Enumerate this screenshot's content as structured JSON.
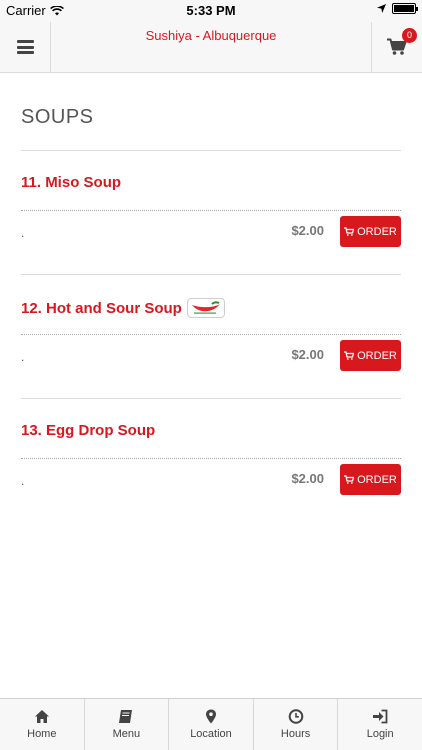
{
  "status_bar": {
    "carrier": "Carrier",
    "time": "5:33 PM"
  },
  "header": {
    "title": "Sushiya - Albuquerque",
    "cart_count": "0"
  },
  "section": {
    "title": "SOUPS"
  },
  "items": [
    {
      "name": "11. Miso Soup",
      "desc": ".",
      "price": "$2.00",
      "order_label": "ORDER",
      "spicy": false
    },
    {
      "name": "12. Hot and Sour Soup",
      "desc": ".",
      "price": "$2.00",
      "order_label": "ORDER",
      "spicy": true
    },
    {
      "name": "13. Egg Drop Soup",
      "desc": ".",
      "price": "$2.00",
      "order_label": "ORDER",
      "spicy": false
    }
  ],
  "tabs": [
    {
      "label": "Home",
      "icon": "home-icon"
    },
    {
      "label": "Menu",
      "icon": "book-icon"
    },
    {
      "label": "Location",
      "icon": "map-marker-icon"
    },
    {
      "label": "Hours",
      "icon": "clock-icon"
    },
    {
      "label": "Login",
      "icon": "login-icon"
    }
  ],
  "colors": {
    "accent": "#d7191e",
    "bar_bg": "#f7f7f7",
    "divider": "#dcdcdc"
  }
}
